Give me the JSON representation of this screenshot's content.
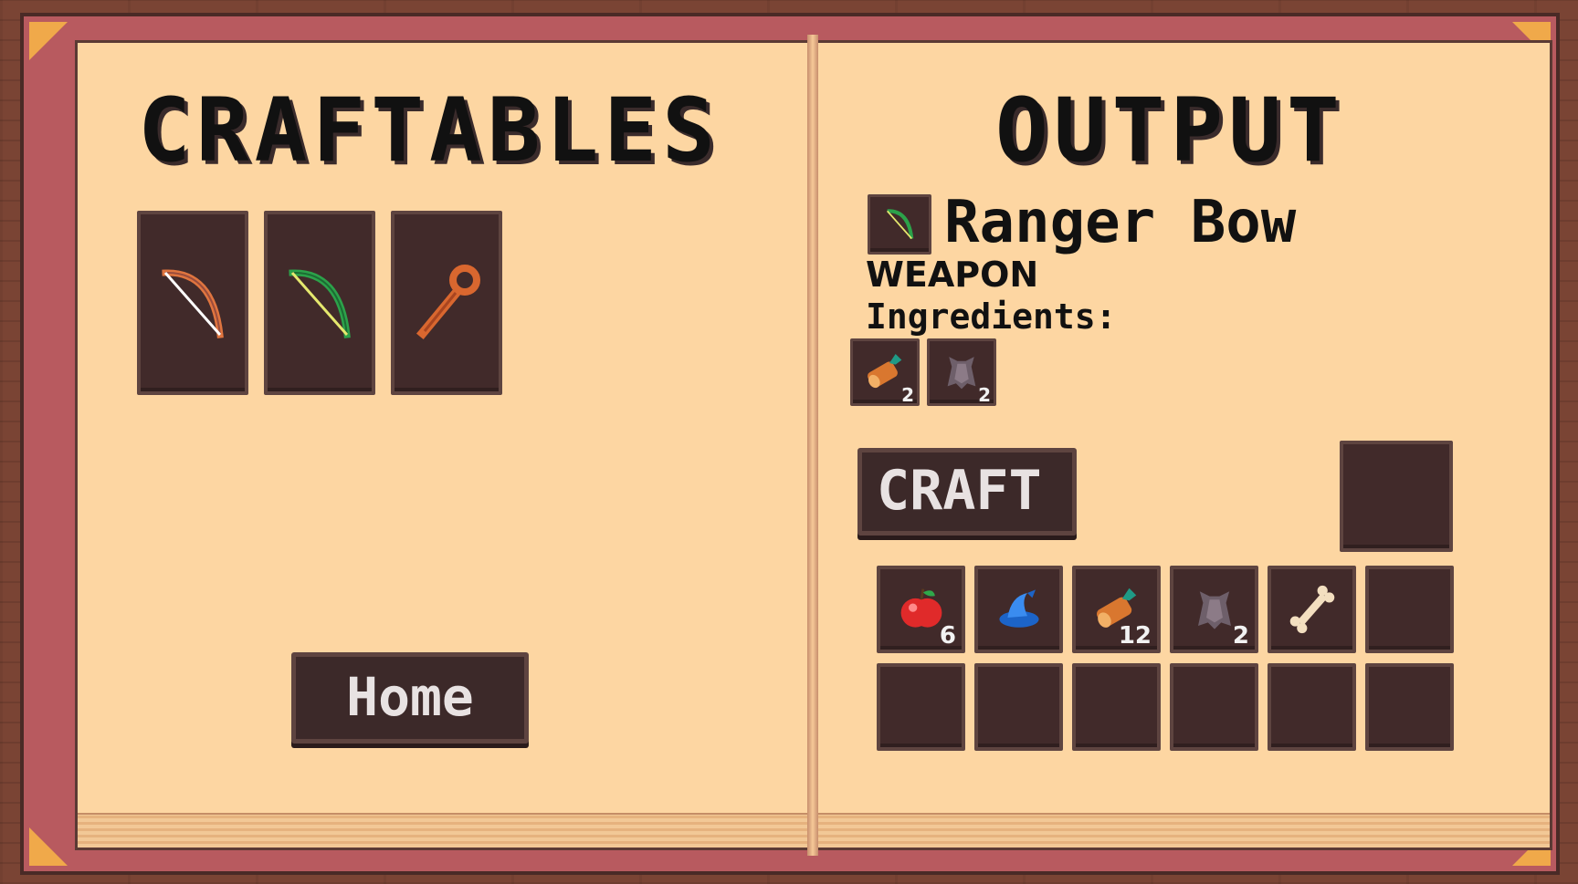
{
  "craftables": {
    "title": "CRAFTABLES",
    "items": [
      {
        "icon": "wooden-bow-icon"
      },
      {
        "icon": "ranger-bow-icon"
      },
      {
        "icon": "wooden-staff-icon"
      }
    ],
    "home_label": "Home"
  },
  "output": {
    "title": "OUTPUT",
    "selected": {
      "icon": "ranger-bow-icon",
      "name": "Ranger Bow",
      "type": "WEAPON"
    },
    "ingredients_label": "Ingredients:",
    "ingredients": [
      {
        "icon": "wood-log-icon",
        "count": "2"
      },
      {
        "icon": "leather-hide-icon",
        "count": "2"
      }
    ],
    "craft_label": "CRAFT",
    "inventory": [
      {
        "icon": "apple-icon",
        "count": "6"
      },
      {
        "icon": "wizard-hat-icon",
        "count": ""
      },
      {
        "icon": "wood-log-icon",
        "count": "12"
      },
      {
        "icon": "leather-hide-icon",
        "count": "2"
      },
      {
        "icon": "bone-icon",
        "count": ""
      },
      {
        "icon": "",
        "count": ""
      },
      {
        "icon": "",
        "count": ""
      },
      {
        "icon": "",
        "count": ""
      },
      {
        "icon": "",
        "count": ""
      },
      {
        "icon": "",
        "count": ""
      },
      {
        "icon": "",
        "count": ""
      },
      {
        "icon": "",
        "count": ""
      }
    ]
  },
  "colors": {
    "page": "#fdd6a2",
    "cover": "#b85a5f",
    "slot": "#412a2a",
    "wood": "#7a4434"
  }
}
